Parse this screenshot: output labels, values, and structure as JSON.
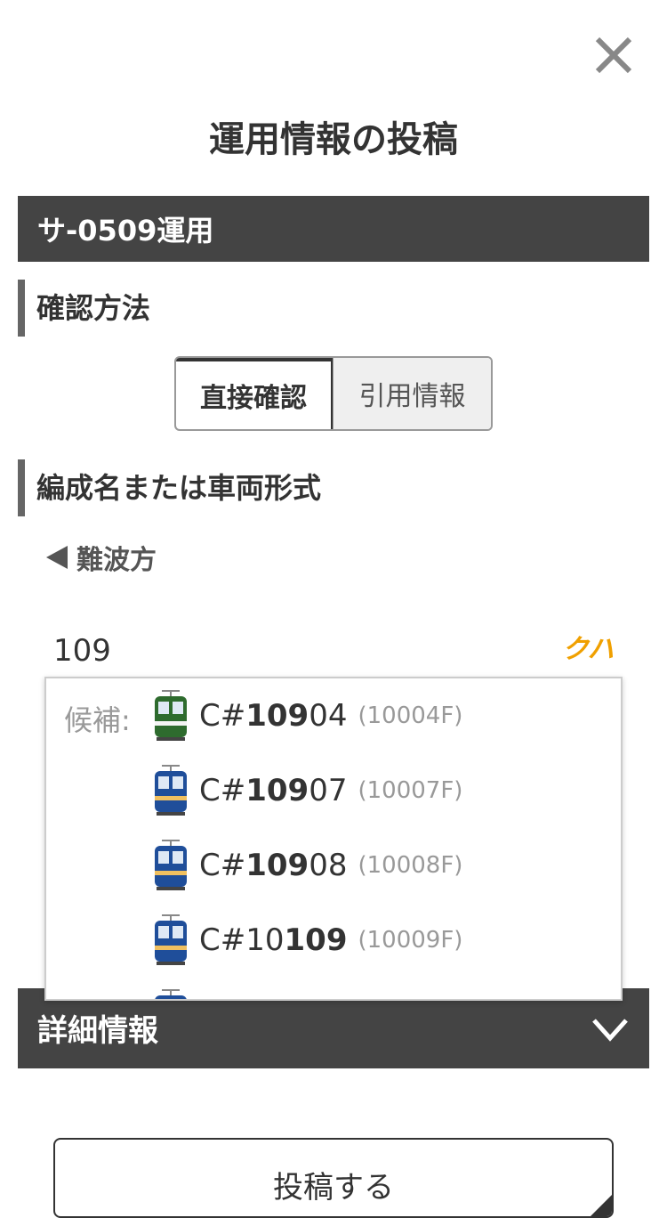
{
  "header": {
    "title": "運用情報の投稿"
  },
  "operation": {
    "label": "サ-0509運用"
  },
  "confirm_method": {
    "heading": "確認方法",
    "options": [
      "直接確認",
      "引用情報"
    ],
    "selected": "直接確認"
  },
  "formation": {
    "heading": "編成名または車両形式",
    "direction": "難波方",
    "input_value": "109",
    "car_type": "クハ",
    "candidates_label": "候補:",
    "candidates": [
      {
        "prefix": "C#",
        "match": "109",
        "suffix": "04",
        "formation": "(10004F)",
        "livery": "green"
      },
      {
        "prefix": "C#",
        "match": "109",
        "suffix": "07",
        "formation": "(10007F)",
        "livery": "blue"
      },
      {
        "prefix": "C#",
        "match": "109",
        "suffix": "08",
        "formation": "(10008F)",
        "livery": "blue"
      },
      {
        "prefix": "C#10",
        "match": "109",
        "suffix": "",
        "formation": "(10009F)",
        "livery": "blue"
      }
    ]
  },
  "details": {
    "label": "詳細情報"
  },
  "submit": {
    "label": "投稿する"
  },
  "colors": {
    "dark_bar": "#444444",
    "accent_orange": "#f0a000",
    "livery_green": "#2e6b2e",
    "livery_blue": "#1f4e9a"
  }
}
